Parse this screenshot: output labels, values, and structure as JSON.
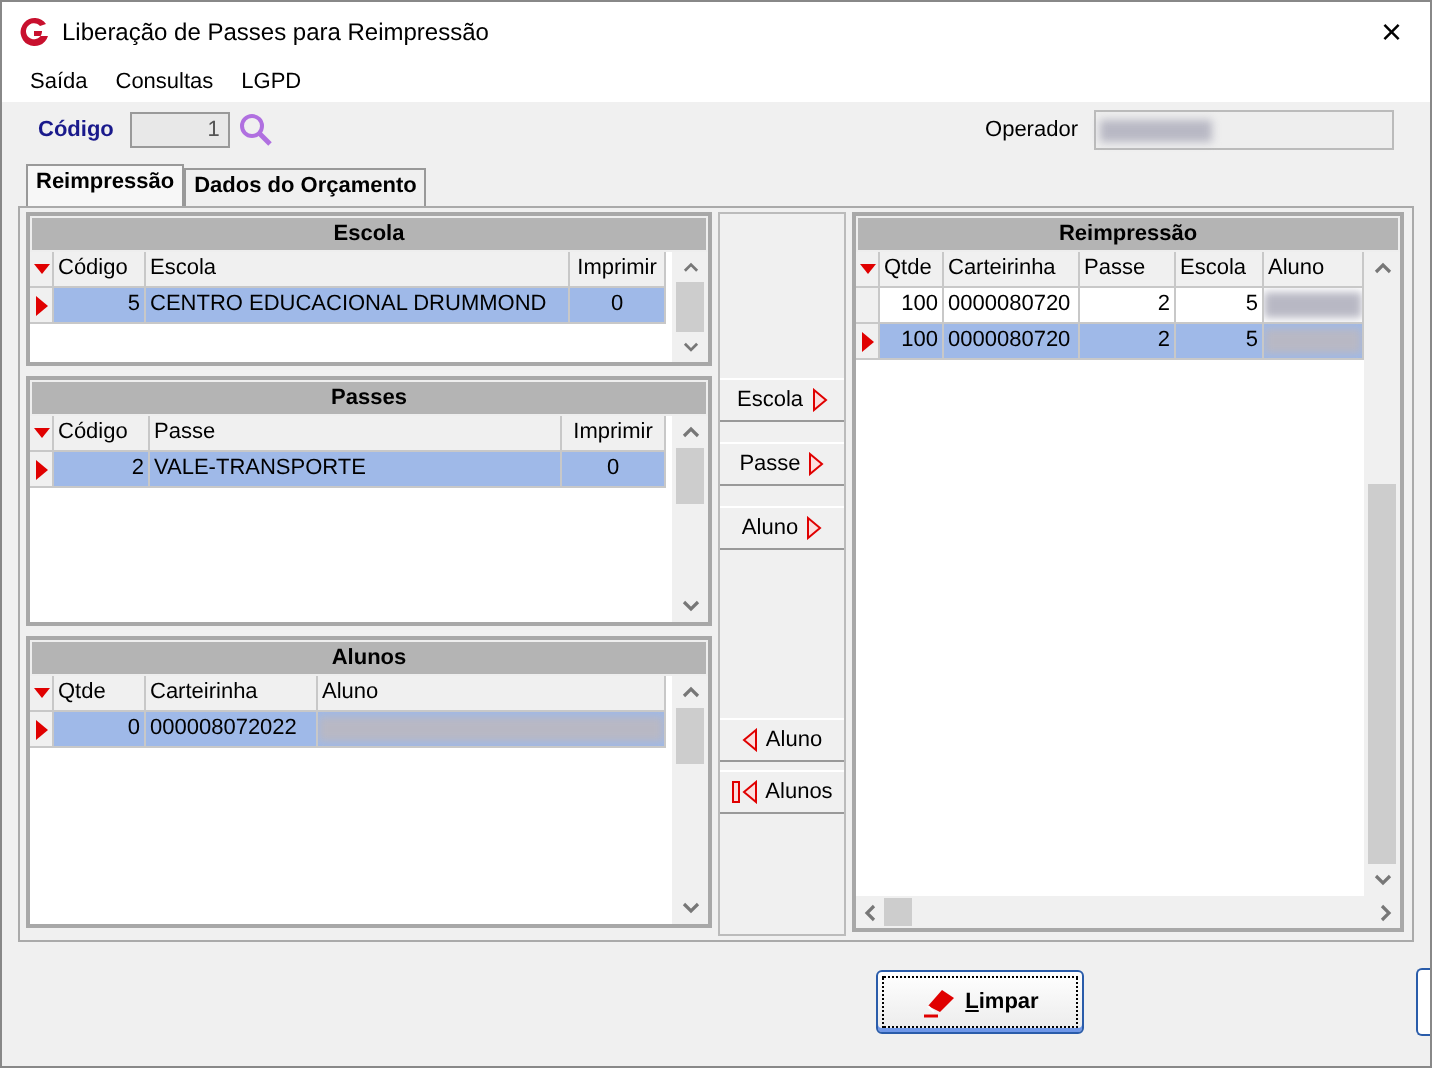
{
  "window": {
    "title": "Liberação de Passes para Reimpressão",
    "close": "×"
  },
  "menu": [
    "Saída",
    "Consultas",
    "LGPD"
  ],
  "codigo": {
    "label": "Código",
    "value": "1"
  },
  "operador": {
    "label": "Operador"
  },
  "tabs": [
    {
      "label": "Reimpressão",
      "selected": true
    },
    {
      "label": "Dados do Orçamento",
      "selected": false
    }
  ],
  "escola": {
    "title": "Escola",
    "columns": [
      "Código",
      "Escola",
      "Imprimir"
    ],
    "rows": [
      {
        "selected": true,
        "cells": [
          "5",
          "CENTRO EDUCACIONAL DRUMMOND",
          "0"
        ]
      }
    ]
  },
  "passes": {
    "title": "Passes",
    "columns": [
      "Código",
      "Passe",
      "Imprimir"
    ],
    "rows": [
      {
        "selected": true,
        "cells": [
          "2",
          "VALE-TRANSPORTE",
          "0"
        ]
      }
    ]
  },
  "alunos": {
    "title": "Alunos",
    "columns": [
      "Qtde",
      "Carteirinha",
      "Aluno"
    ],
    "rows": [
      {
        "selected": true,
        "cells": [
          "0",
          "000008072022",
          null
        ]
      }
    ]
  },
  "actions": [
    {
      "kind": "forward",
      "label": "Escola"
    },
    {
      "kind": "forward",
      "label": "Passe"
    },
    {
      "kind": "forward",
      "label": "Aluno"
    },
    {
      "kind": "back",
      "label": "Aluno"
    },
    {
      "kind": "back_all",
      "label": "Alunos"
    }
  ],
  "reimpressao": {
    "title": "Reimpressão",
    "columns": [
      "Qtde",
      "Carteirinha",
      "Passe",
      "Escola",
      "Aluno"
    ],
    "rows": [
      {
        "selected": false,
        "cells": [
          "100",
          "0000080720",
          "2",
          "5",
          null
        ]
      },
      {
        "selected": true,
        "cells": [
          "100",
          "0000080720",
          "2",
          "5",
          null
        ]
      }
    ]
  },
  "buttons": [
    {
      "label": "Limpar"
    }
  ]
}
